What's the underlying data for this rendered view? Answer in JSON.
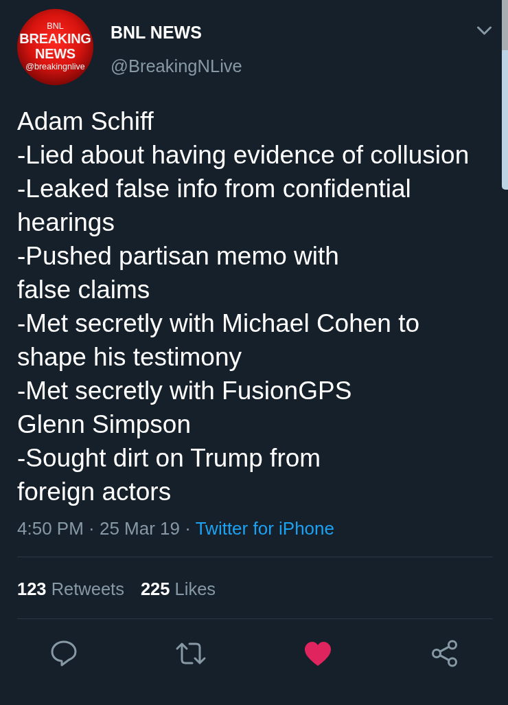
{
  "author": {
    "avatar": {
      "texts": [
        {
          "text": "BNL",
          "kind": "caption"
        },
        {
          "text": "BREAKING",
          "kind": "headline"
        },
        {
          "text": "NEWS",
          "kind": "headline"
        },
        {
          "text": "@breakingnlive",
          "kind": "caption"
        }
      ]
    },
    "name": "BNL NEWS",
    "handle": "@BreakingNLive"
  },
  "tweet": {
    "text": "Adam Schiff\n-Lied about having evidence of collusion\n-Leaked false info from confidential hearings\n-Pushed partisan memo with\nfalse claims\n-Met secretly with Michael Cohen to shape his testimony\n-Met secretly with FusionGPS\nGlenn Simpson\n-Sought dirt on Trump from\nforeign actors",
    "timestamp": "4:50 PM · 25 Mar 19 ·",
    "source": "Twitter for iPhone"
  },
  "stats": [
    {
      "count": "123",
      "label": "Retweets"
    },
    {
      "count": "225",
      "label": "Likes"
    }
  ],
  "actions": {
    "retweeted": false,
    "liked": true
  }
}
